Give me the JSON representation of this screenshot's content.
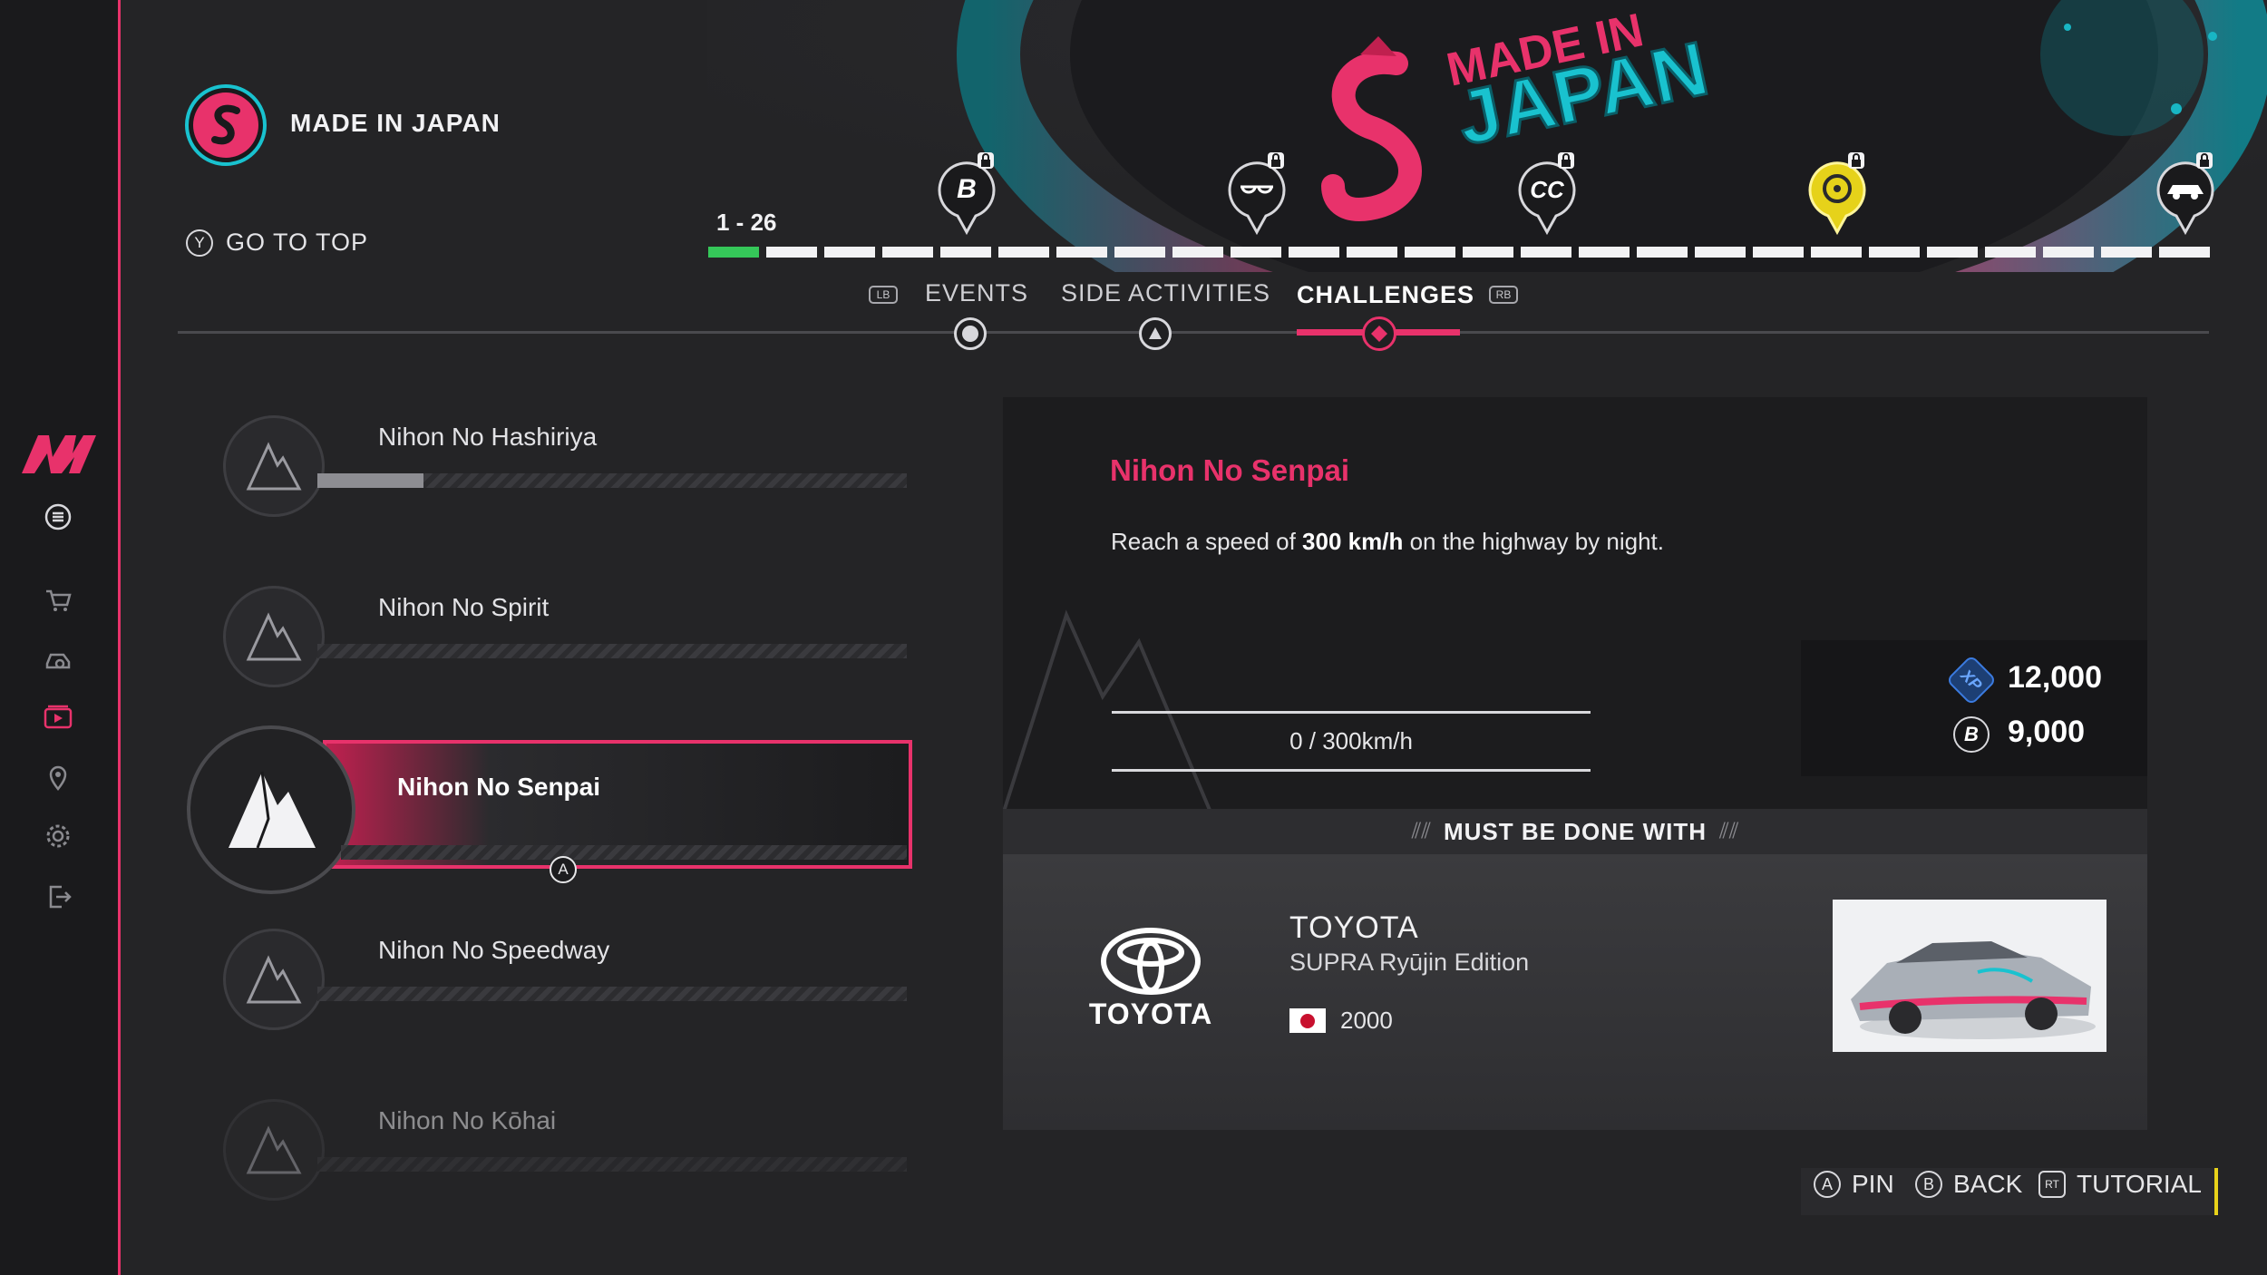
{
  "header": {
    "title": "MADE IN JAPAN",
    "go_to_top_button": "Y",
    "go_to_top": "GO TO TOP",
    "range": "1 - 26",
    "banner_logo_text_1": "MADE IN",
    "banner_logo_text_2": "JAPAN"
  },
  "progress": {
    "segments": 26,
    "completed": 1,
    "milestones": [
      {
        "icon": "bitcoin-reward-icon",
        "locked": true,
        "highlight": false
      },
      {
        "icon": "sunglasses-reward-icon",
        "locked": true,
        "highlight": false
      },
      {
        "icon": "cc-currency-reward-icon",
        "locked": true,
        "highlight": false
      },
      {
        "icon": "wheel-reward-icon",
        "locked": true,
        "highlight": true
      },
      {
        "icon": "car-reward-icon",
        "locked": true,
        "highlight": false
      }
    ]
  },
  "tabs": {
    "lb": "LB",
    "rb": "RB",
    "events": "EVENTS",
    "side_activities": "SIDE ACTIVITIES",
    "challenges": "CHALLENGES",
    "active": "challenges"
  },
  "challenges": [
    {
      "title": "Nihon No Hashiriya",
      "progress": 0.18,
      "selected": false,
      "dim": false
    },
    {
      "title": "Nihon No Spirit",
      "progress": 0,
      "selected": false,
      "dim": false
    },
    {
      "title": "Nihon No Senpai",
      "progress": 0,
      "selected": true,
      "dim": false,
      "button": "A"
    },
    {
      "title": "Nihon No Speedway",
      "progress": 0,
      "selected": false,
      "dim": false
    },
    {
      "title": "Nihon No Kōhai",
      "progress": 0,
      "selected": false,
      "dim": true
    }
  ],
  "detail": {
    "title": "Nihon No Senpai",
    "desc_pre": "Reach a speed of ",
    "desc_bold": "300 km/h",
    "desc_post": " on the highway by night.",
    "progress_text": "0 / 300km/h",
    "xp_label": "XP",
    "xp": "12,000",
    "bucks_label": "B",
    "bucks": "9,000",
    "must_be_done": "MUST BE DONE WITH",
    "car": {
      "logo_text": "TOYOTA",
      "make": "TOYOTA",
      "model": "SUPRA Ryūjin Edition",
      "year": "2000"
    }
  },
  "hints": {
    "pin_button": "A",
    "pin": "PIN",
    "back_button": "B",
    "back": "BACK",
    "tutorial_button": "RT",
    "tutorial": "TUTORIAL"
  },
  "colors": {
    "accent": "#e8326b",
    "progress_green": "#35c759",
    "gold": "#e6d21a"
  }
}
